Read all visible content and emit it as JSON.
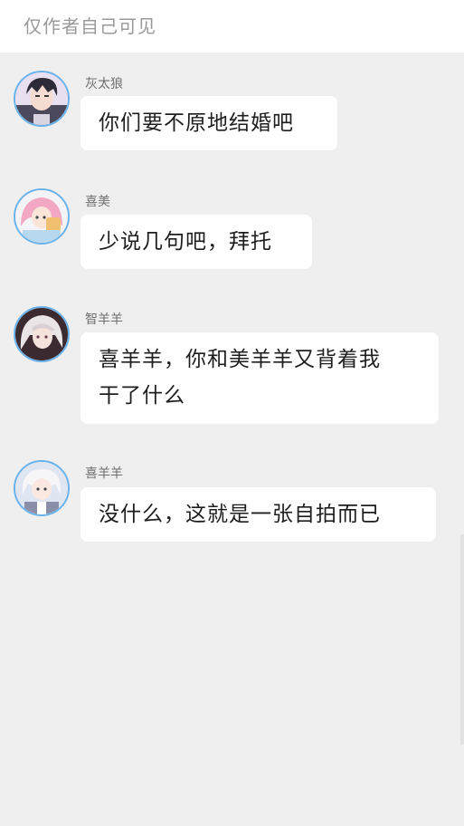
{
  "header": {
    "title": "仅作者自己可见"
  },
  "messages": [
    {
      "sender": "灰太狼",
      "text": "你们要不原地结婚吧",
      "avatar_icon": "wolf-character-avatar-icon"
    },
    {
      "sender": "喜美",
      "text": "少说几句吧，拜托",
      "avatar_icon": "pink-hair-girl-avatar-icon"
    },
    {
      "sender": "智羊羊",
      "text_lines": [
        "喜羊羊，你和美羊羊又背着我",
        "干了什么"
      ],
      "avatar_icon": "silver-hair-avatar-icon"
    },
    {
      "sender": "喜羊羊",
      "text": "没什么，这就是一张自拍而已",
      "avatar_icon": "white-hair-boy-avatar-icon"
    }
  ],
  "colors": {
    "background": "#efefef",
    "bubble": "#ffffff",
    "avatar_ring": "#6ab2ea",
    "sender_text": "#6f6f6f",
    "message_text": "#1e1e1e"
  }
}
